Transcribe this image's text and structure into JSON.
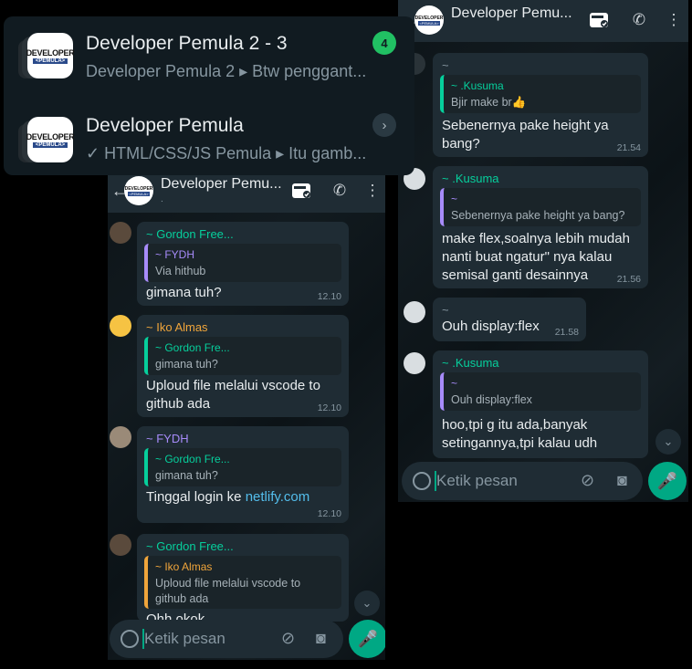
{
  "chat_list": [
    {
      "name": "Developer Pemula 2 - 3",
      "preview": "Developer Pemula 2 ▸ Btw penggant...",
      "unread": "4"
    },
    {
      "name": "Developer Pemula",
      "preview": "✓ HTML/CSS/JS Pemula ▸ Itu gamb..."
    }
  ],
  "logo": {
    "line1": "DEVELOPER",
    "line2": "<PEMULA>"
  },
  "left_phone": {
    "title": "Developer Pemu...",
    "status": ".",
    "messages": [
      {
        "sender": "~ Gordon Free...",
        "quote_name": "~ FYDH",
        "quote_text": "Via hithub",
        "text": "gimana tuh?",
        "time": "12.10"
      },
      {
        "sender": "~ Iko Almas",
        "quote_name": "~ Gordon Fre...",
        "quote_text": "gimana tuh?",
        "text": "Uploud file melalui vscode to github ada",
        "time": "12.10"
      },
      {
        "sender": "~ FYDH",
        "quote_name": "~ Gordon Fre...",
        "quote_text": "gimana tuh?",
        "text_pre": "Tinggal login ke ",
        "link": "netlify.com",
        "time": "12.10"
      },
      {
        "sender": "~ Gordon Free...",
        "quote_name": "~ Iko Almas",
        "quote_text": "Uploud file melalui vscode to github ada",
        "text": "Ohh okok"
      }
    ],
    "placeholder": "Ketik pesan"
  },
  "right_phone": {
    "title": "Developer Pemu...",
    "messages": [
      {
        "sender": "~",
        "quote_name": "~ .Kusuma",
        "quote_text": "Bjir make br👍",
        "text": "Sebenernya pake height ya bang?",
        "time": "21.54"
      },
      {
        "sender": "~ .Kusuma",
        "quote_name": "~",
        "quote_text": "Sebenernya pake height ya bang?",
        "text": "make flex,soalnya lebih mudah nanti buat ngatur\" nya kalau semisal ganti desainnya",
        "time": "21.56"
      },
      {
        "sender": "~",
        "text": "Ouh display:flex",
        "time": "21.58"
      },
      {
        "sender": "~ .Kusuma",
        "quote_name": "~",
        "quote_text": "Ouh display:flex",
        "text": "hoo,tpi g itu ada,banyak setingannya,tpi kalau udh"
      }
    ],
    "placeholder": "Ketik pesan"
  },
  "colors": {
    "accent": "#00a884",
    "badge": "#21c063",
    "green_name": "#06cf9c",
    "orange_name": "#f0a53b",
    "purple_name": "#a78bfa",
    "link": "#53bdeb"
  },
  "icons": [
    "back-arrow-icon",
    "video-call-icon",
    "add-call-icon",
    "menu-dots-icon",
    "emoji-icon",
    "attach-icon",
    "camera-icon",
    "mic-icon",
    "chevron-down-icon"
  ]
}
